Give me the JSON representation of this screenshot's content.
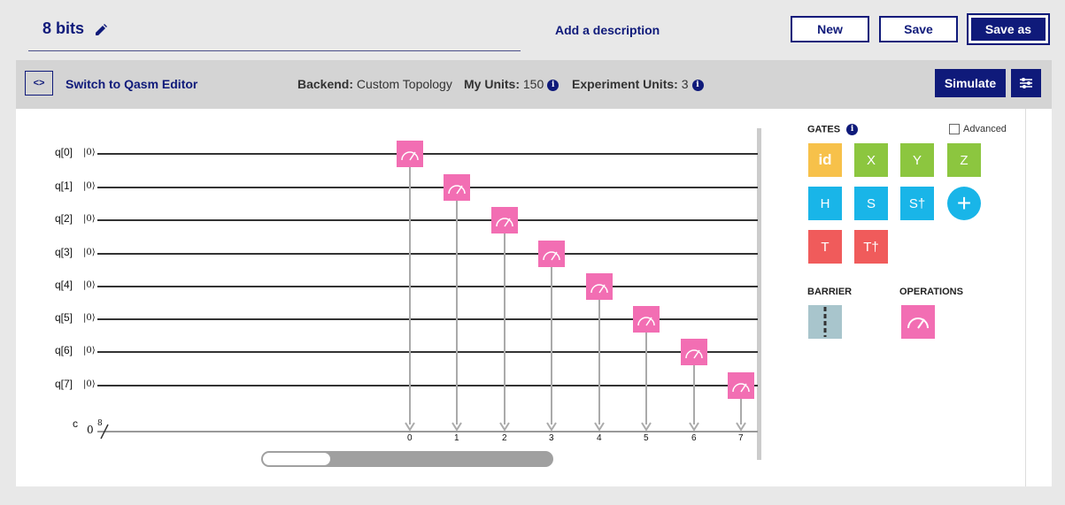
{
  "header": {
    "title": "8 bits",
    "add_description": "Add a description",
    "buttons": {
      "new": "New",
      "save": "Save",
      "save_as": "Save as"
    }
  },
  "toolbar": {
    "qasm_icon": "<>",
    "qasm_label": "Switch to Qasm Editor",
    "backend_key": "Backend:",
    "backend_value": "Custom Topology",
    "my_units_key": "My Units:",
    "my_units_value": "150",
    "exp_units_key": "Experiment Units:",
    "exp_units_value": "3",
    "simulate": "Simulate"
  },
  "circuit": {
    "qubits": [
      "q[0]",
      "q[1]",
      "q[2]",
      "q[3]",
      "q[4]",
      "q[5]",
      "q[6]",
      "q[7]"
    ],
    "init_state": "|0⟩",
    "classical": {
      "label": "c",
      "value": "0",
      "width": "8"
    },
    "measure_targets": [
      "0",
      "1",
      "2",
      "3",
      "4",
      "5",
      "6",
      "7"
    ],
    "measure_icon": "measure-icon"
  },
  "gates_panel": {
    "title": "GATES",
    "advanced_label": "Advanced",
    "advanced_checked": false,
    "gates": [
      {
        "label": "id",
        "color": "#f7c14a"
      },
      {
        "label": "X",
        "color": "#8cc63f"
      },
      {
        "label": "Y",
        "color": "#8cc63f"
      },
      {
        "label": "Z",
        "color": "#8cc63f"
      },
      {
        "label": "H",
        "color": "#19b5e8"
      },
      {
        "label": "S",
        "color": "#19b5e8"
      },
      {
        "label": "S†",
        "color": "#19b5e8"
      },
      {
        "label": "+",
        "color": "#19b5e8"
      },
      {
        "label": "T",
        "color": "#f05b5b"
      },
      {
        "label": "T†",
        "color": "#f05b5b"
      }
    ],
    "barrier_title": "BARRIER",
    "operations_title": "OPERATIONS"
  },
  "colors": {
    "brand": "#0f1a7a",
    "measure": "#f26eb3",
    "barrier": "#a8c5cc"
  }
}
